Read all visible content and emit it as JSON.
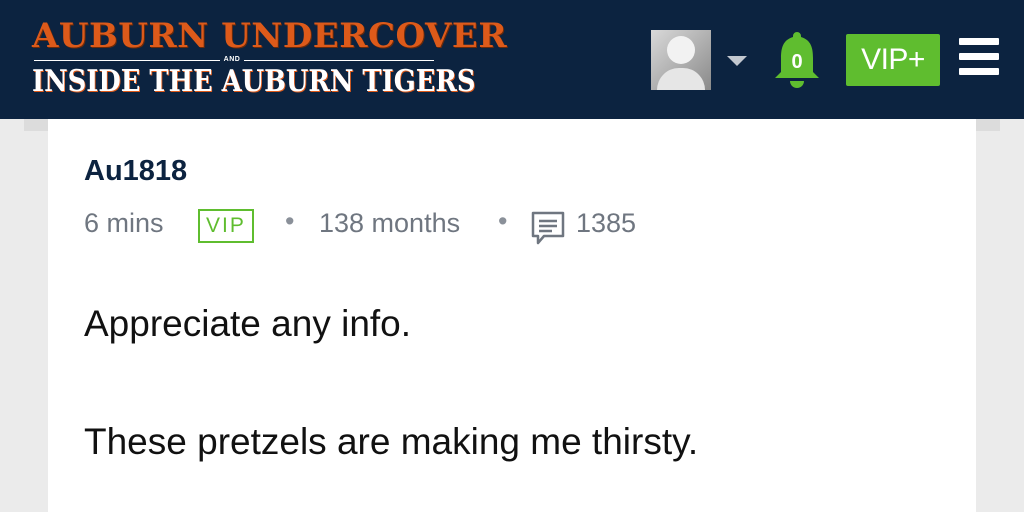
{
  "header": {
    "logo": {
      "line1": "Auburn Undercover",
      "and": "AND",
      "line2": "Inside the Auburn Tigers"
    },
    "notifications": {
      "count": "0",
      "icon": "bell-icon"
    },
    "vip_button_label": "VIP+",
    "menu_icon": "hamburger-menu-icon",
    "colors": {
      "bar": "#0c2340",
      "accent": "#dd5a1a",
      "vip_green": "#5fbd2f"
    }
  },
  "post": {
    "username": "Au1818",
    "time": "6 mins",
    "badge": "VIP",
    "separator": "•",
    "membership": "138 months",
    "post_count_icon": "message-icon",
    "post_count": "1385",
    "paragraphs": [
      "Appreciate any info.",
      "These pretzels are making me thirsty."
    ]
  }
}
